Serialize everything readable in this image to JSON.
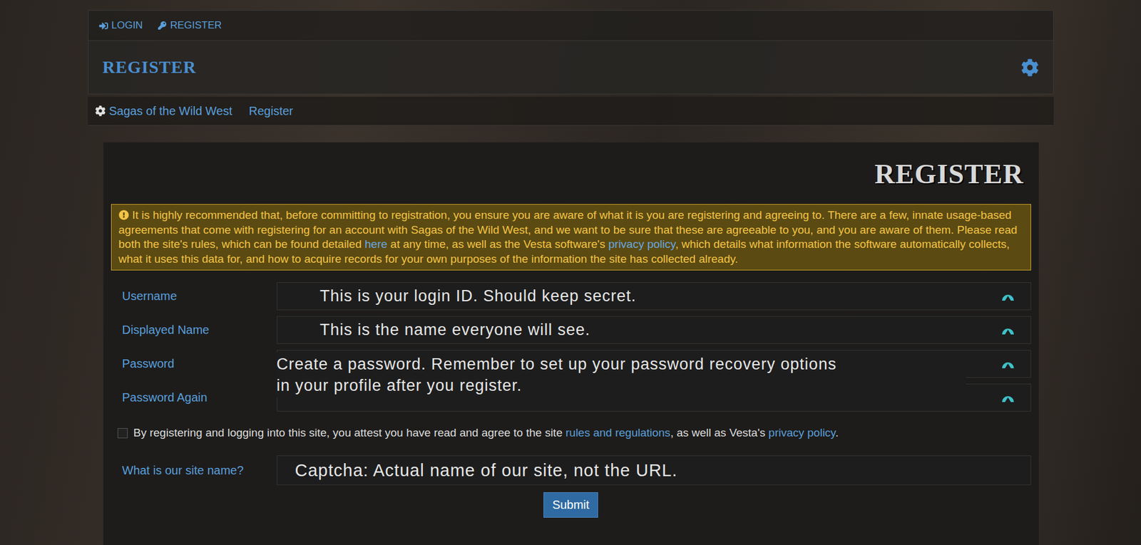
{
  "topbar": {
    "links": [
      {
        "label": "LOGIN",
        "icon": "login"
      },
      {
        "label": "REGISTER",
        "icon": "key"
      }
    ]
  },
  "header": {
    "title": "REGISTER"
  },
  "breadcrumbs": [
    {
      "label": "Sagas of the Wild West",
      "icon": true
    },
    {
      "label": "Register",
      "icon": false
    }
  ],
  "page": {
    "heading": "REGISTER"
  },
  "notice": {
    "segments": [
      {
        "text": "It is highly recommended that, before committing to registration, you ensure you are aware of what it is you are registering and agreeing to. There are a few, innate usage-based agreements that come with registering for an account with Sagas of the Wild West, and we want to be sure that these are agreeable to you, and you are aware of them. Please read both the site's rules, which can be found detailed ",
        "link": false
      },
      {
        "text": "here",
        "link": true
      },
      {
        "text": " at any time, as well as the Vesta software's ",
        "link": false
      },
      {
        "text": "privacy policy",
        "link": true
      },
      {
        "text": ", which details what information the software automatically collects, what it uses this data for, and how to acquire records for your own purposes of the information the site has collected already.",
        "link": false
      }
    ]
  },
  "fields": [
    {
      "label": "Username",
      "value": "This is your login ID. Should keep secret."
    },
    {
      "label": "Displayed Name",
      "value": "This is the name everyone will see."
    }
  ],
  "password_fields": [
    {
      "label": "Password",
      "value": ""
    },
    {
      "label": "Password Again",
      "value": ""
    }
  ],
  "password_note": {
    "lines": [
      "Create a password. Remember to set up your password recovery options",
      "in your profile after you register."
    ]
  },
  "agreement": {
    "checked": false,
    "segments": [
      {
        "text": "By registering and logging into this site, you attest you have read and agree to the site ",
        "link": false
      },
      {
        "text": "rules and regulations",
        "link": true
      },
      {
        "text": ", as well as Vesta's ",
        "link": false
      },
      {
        "text": "privacy policy",
        "link": true
      },
      {
        "text": ".",
        "link": false
      }
    ]
  },
  "captcha": {
    "label": "What is our site name?",
    "value": "Captcha: Actual name of our site, not the URL."
  },
  "submit": {
    "label": "Submit"
  }
}
